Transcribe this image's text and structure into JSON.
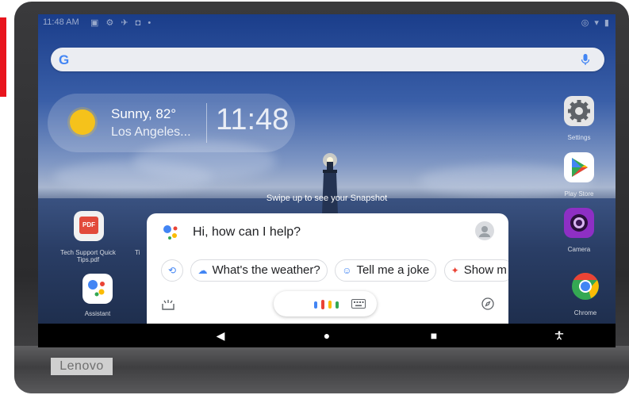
{
  "status_bar": {
    "time": "11:48 AM",
    "left_icons": "▣ ⚙ ✈ ◘ •",
    "right_icons": "◎ ▾ ▮"
  },
  "search": {
    "logo": "G",
    "mic_icon": "mic-icon"
  },
  "weather": {
    "condition": "Sunny, 82°",
    "city": "Los Angeles...",
    "clock": "11:48"
  },
  "snapshot_hint": "Swipe up to see your Snapshot",
  "apps": {
    "left": [
      {
        "label": "Tech Support Quick Tips.pdf",
        "icon": "pdf-icon",
        "badge": "PDF"
      },
      {
        "label": "Ti",
        "icon": "partial-icon"
      },
      {
        "label": "Assistant",
        "icon": "assistant-icon"
      }
    ],
    "right": [
      {
        "label": "Settings",
        "icon": "gear-icon"
      },
      {
        "label": "Play Store",
        "icon": "play-store-icon"
      },
      {
        "label": "Camera",
        "icon": "camera-icon"
      },
      {
        "label": "Chrome",
        "icon": "chrome-icon"
      }
    ]
  },
  "assistant": {
    "greeting": "Hi, how can I help?",
    "chips": [
      {
        "label": "What's the weather?",
        "icon": "cloud-icon"
      },
      {
        "label": "Tell me a joke",
        "icon": "smiley-icon"
      },
      {
        "label": "Show m",
        "icon": "sparkle-icon"
      }
    ]
  },
  "nav": {
    "back": "◀",
    "home": "●",
    "recents": "■",
    "accessibility": "🯅"
  },
  "brand": "Lenovo",
  "colors": {
    "accent_red": "#e8141d",
    "google_blue": "#4285f4",
    "google_red": "#ea4335",
    "google_yellow": "#fbbc05",
    "google_green": "#34a853"
  }
}
